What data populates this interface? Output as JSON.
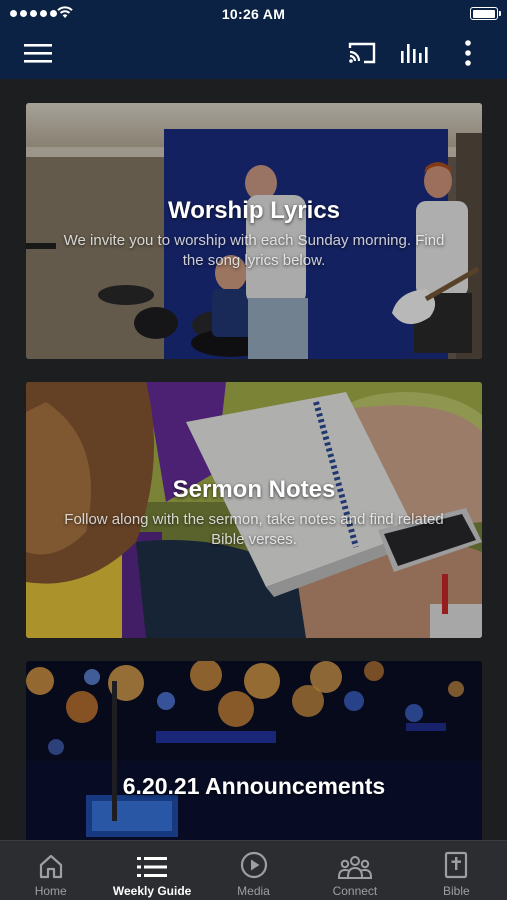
{
  "status_bar": {
    "time": "10:26 AM"
  },
  "app_bar": {
    "icons": [
      "menu-icon",
      "cast-icon",
      "equalizer-icon",
      "more-vertical-icon"
    ]
  },
  "cards": [
    {
      "title": "Worship Lyrics",
      "subtitle": "We invite you to worship with each Sunday morning. Find the song lyrics below."
    },
    {
      "title": "Sermon Notes",
      "subtitle": "Follow along with the sermon, take notes and find related Bible verses."
    },
    {
      "title": "6.20.21 Announcements",
      "subtitle": ""
    }
  ],
  "tab_bar": {
    "active": "Weekly Guide",
    "tabs": [
      {
        "label": "Home",
        "icon": "home-icon"
      },
      {
        "label": "Weekly Guide",
        "icon": "list-icon"
      },
      {
        "label": "Media",
        "icon": "play-circle-icon"
      },
      {
        "label": "Connect",
        "icon": "people-icon"
      },
      {
        "label": "Bible",
        "icon": "bible-icon"
      }
    ]
  },
  "colors": {
    "header_bg": "#0b2244",
    "page_bg": "#1d1e20",
    "tabbar_bg": "#2b2d30",
    "tab_inactive": "#9c9fa4",
    "tab_active": "#ffffff"
  }
}
